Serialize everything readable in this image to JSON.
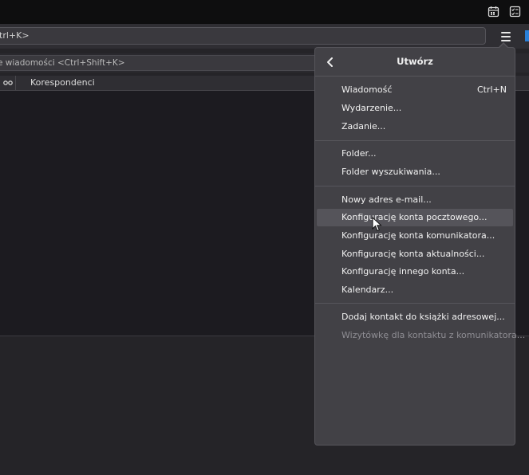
{
  "toolbar": {
    "search_text": "trl+K>",
    "filter_text": "e wiadomości <Ctrl+Shift+K>"
  },
  "columns": {
    "correspondents": "Korespondenci"
  },
  "menu": {
    "title": "Utwórz",
    "groups": [
      [
        {
          "label": "Wiadomość",
          "shortcut": "Ctrl+N"
        },
        {
          "label": "Wydarzenie..."
        },
        {
          "label": "Zadanie..."
        }
      ],
      [
        {
          "label": "Folder..."
        },
        {
          "label": "Folder wyszukiwania..."
        }
      ],
      [
        {
          "label": "Nowy adres e-mail..."
        },
        {
          "label": "Konfigurację konta pocztowego..."
        },
        {
          "label": "Konfigurację konta komunikatora..."
        },
        {
          "label": "Konfigurację konta aktualności..."
        },
        {
          "label": "Konfigurację innego konta..."
        },
        {
          "label": "Kalendarz..."
        }
      ],
      [
        {
          "label": "Dodaj kontakt do książki adresowej..."
        },
        {
          "label": "Wizytówkę dla kontaktu z komunikatora..."
        }
      ]
    ]
  },
  "icons": {
    "top_right": [
      "calendar-icon",
      "tasks-icon"
    ],
    "menu": "hamburger-menu-icon",
    "back": "chevron-left-icon"
  },
  "colors": {
    "accent": "#2a80d8",
    "menu_bg": "#424146",
    "hover_bg": "#55545a"
  }
}
